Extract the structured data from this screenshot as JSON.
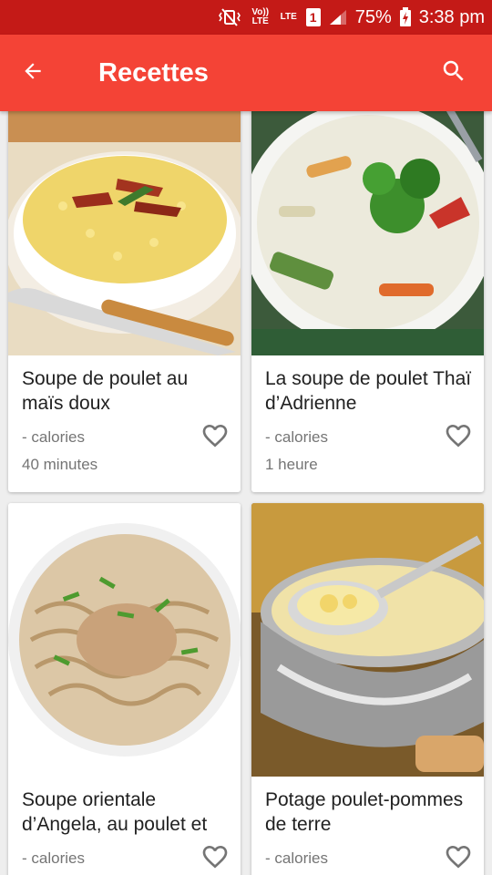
{
  "status_bar": {
    "battery": "75%",
    "time": "3:38 pm",
    "volte_label": "Vo)) LTE",
    "lte_label": "LTE",
    "sim_label": "1"
  },
  "app_bar": {
    "title": "Recettes",
    "back_icon": "arrow-left-icon",
    "search_icon": "search-icon"
  },
  "recipes": [
    {
      "title": "Soupe de poulet au maïs doux",
      "calories": "- calories",
      "time": "40 minutes",
      "image": "corn-chicken-soup"
    },
    {
      "title": "La soupe de poulet Thaï d’Adrienne",
      "calories": "- calories",
      "time": "1 heure",
      "image": "thai-chicken-soup"
    },
    {
      "title": "Soupe orientale d’Angela, au poulet et",
      "calories": "- calories",
      "time": "",
      "image": "noodle-chicken-soup"
    },
    {
      "title": "Potage poulet-pommes de terre",
      "calories": "- calories",
      "time": "",
      "image": "chicken-potato-soup"
    }
  ],
  "colors": {
    "status_bar": "#c41a17",
    "app_bar": "#f44336",
    "background": "#eeeeee"
  }
}
